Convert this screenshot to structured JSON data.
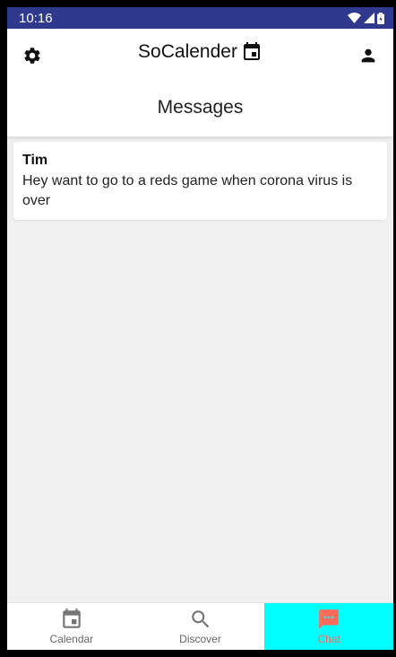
{
  "status_bar": {
    "time": "10:16"
  },
  "app": {
    "title": "SoCalender"
  },
  "page": {
    "title": "Messages"
  },
  "messages": [
    {
      "sender": "Tim",
      "text": "Hey want to go to a reds game when corona virus is over"
    }
  ],
  "nav": {
    "items": [
      {
        "label": "Calendar",
        "icon": "calendar-icon"
      },
      {
        "label": "Discover",
        "icon": "search-icon"
      },
      {
        "label": "Chat",
        "icon": "chat-icon",
        "active": true
      }
    ]
  },
  "colors": {
    "status_bar": "#2f3a8f",
    "active_tab_bg": "#00ffff",
    "active_tab_fg": "#ff6b5b",
    "background": "#f0f0f0"
  }
}
